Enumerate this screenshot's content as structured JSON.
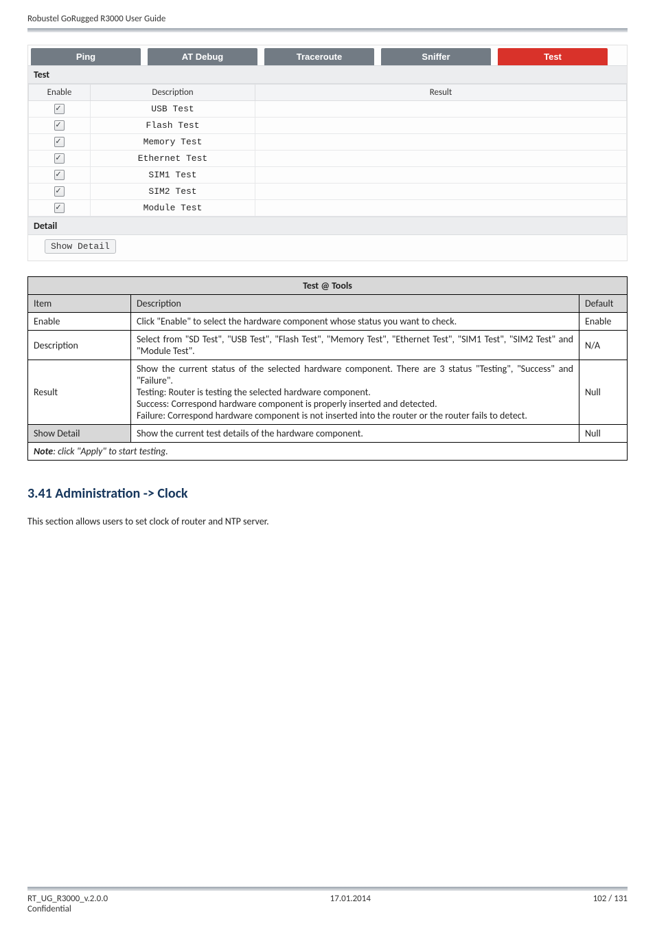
{
  "header": {
    "title": "Robustel GoRugged R3000 User Guide"
  },
  "screenshot": {
    "tabs": [
      "Ping",
      "AT Debug",
      "Traceroute",
      "Sniffer",
      "Test"
    ],
    "active_tab_index": 4,
    "section_test_label": "Test",
    "grid_headers": {
      "enable": "Enable",
      "description": "Description",
      "result": "Result"
    },
    "rows": [
      {
        "desc": "USB Test"
      },
      {
        "desc": "Flash Test"
      },
      {
        "desc": "Memory Test"
      },
      {
        "desc": "Ethernet Test"
      },
      {
        "desc": "SIM1 Test"
      },
      {
        "desc": "SIM2 Test"
      },
      {
        "desc": "Module Test"
      }
    ],
    "section_detail_label": "Detail",
    "show_detail_label": "Show Detail"
  },
  "desc_table": {
    "title": "Test @ Tools",
    "headers": {
      "item": "Item",
      "description": "Description",
      "default": "Default"
    },
    "rows": [
      {
        "item": "Enable",
        "desc": "Click \"Enable\" to select the hardware component whose status you want to check.",
        "def": "Enable"
      },
      {
        "item": "Description",
        "desc": "Select from \"SD Test\", \"USB Test\", \"Flash Test\", \"Memory Test\", \"Ethernet Test\", \"SIM1 Test\", \"SIM2 Test\" and \"Module Test\".",
        "def": "N/A"
      },
      {
        "item": "Result",
        "desc": "Show the current status of the selected hardware component. There are 3 status \"Testing\", \"Success\" and \"Failure\".\nTesting: Router is testing the selected hardware component.\nSuccess: Correspond hardware component is properly inserted and detected.\nFailure: Correspond hardware component is not inserted into the router or the router fails to detect.",
        "def": "Null"
      },
      {
        "item": "Show Detail",
        "desc": "Show the current test details of the hardware component.",
        "def": "Null"
      }
    ],
    "note_prefix": "Note",
    "note_rest": ": click \"Apply\" to start testing."
  },
  "section_heading": "3.41  Administration -> Clock",
  "body_text": "This section allows users to set clock of router and NTP server.",
  "footer": {
    "left_line1": "RT_UG_R3000_v.2.0.0",
    "left_line2": "Confidential",
    "center": "17.01.2014",
    "right": "102 / 131"
  }
}
